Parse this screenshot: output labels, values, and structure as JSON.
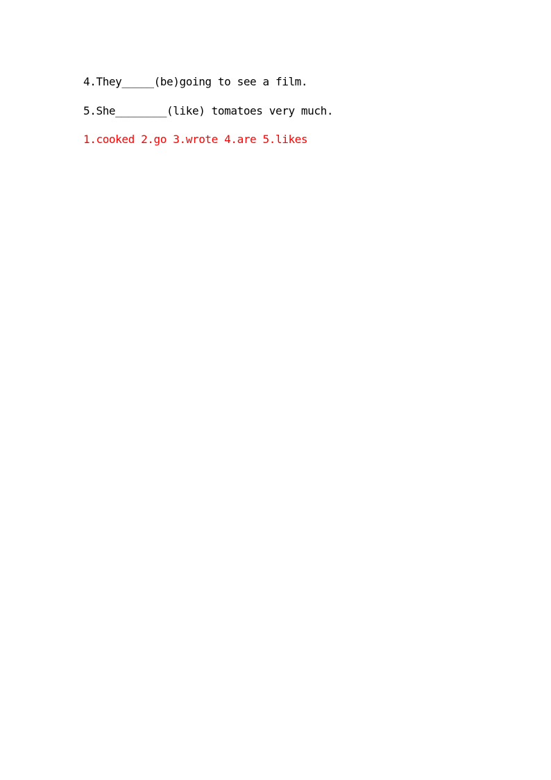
{
  "questions": [
    {
      "number": "4.",
      "text": "They_____(be)going to see a film."
    },
    {
      "number": "5.",
      "text": "She________(like) tomatoes very much."
    }
  ],
  "answers": {
    "text": "1.cooked 2.go 3.wrote 4.are 5.likes",
    "color": "#ff0000"
  }
}
